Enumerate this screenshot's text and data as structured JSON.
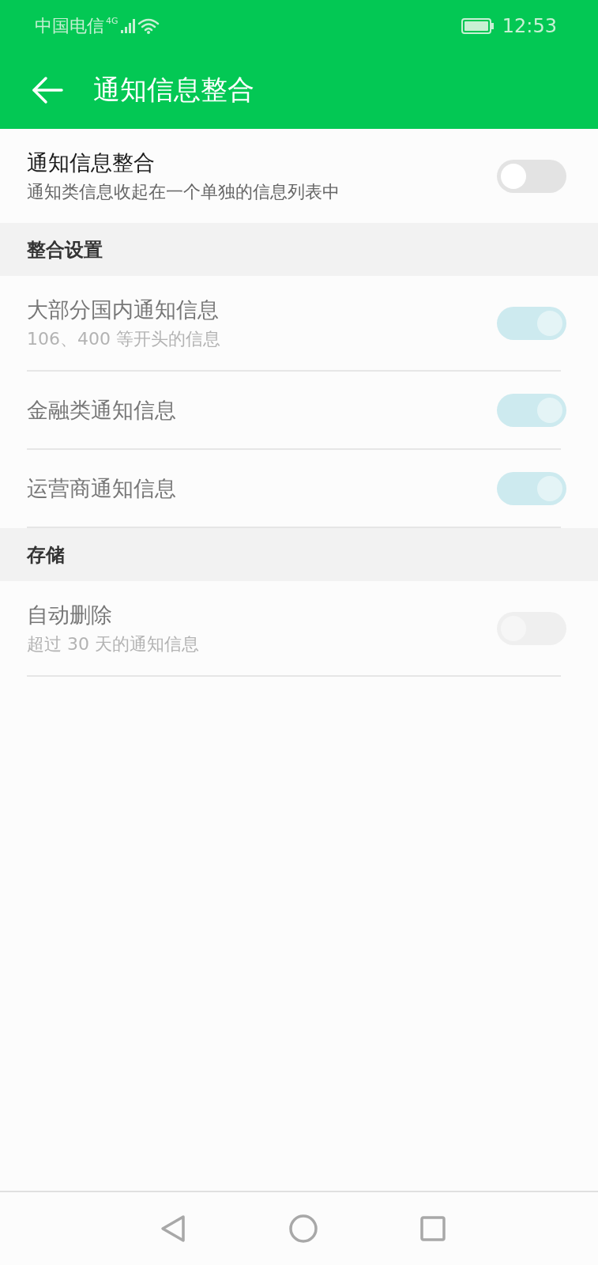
{
  "status_bar": {
    "carrier": "中国电信",
    "network": "4G",
    "time": "12:53"
  },
  "app_bar": {
    "title": "通知信息整合"
  },
  "sections": [
    {
      "items": [
        {
          "title": "通知信息整合",
          "subtitle": "通知类信息收起在一个单独的信息列表中",
          "on": false,
          "disabled": false
        }
      ]
    },
    {
      "header": "整合设置",
      "items": [
        {
          "title": "大部分国内通知信息",
          "subtitle": "106、400 等开头的信息",
          "on": true,
          "disabled": true
        },
        {
          "title": "金融类通知信息",
          "on": true,
          "disabled": true
        },
        {
          "title": "运营商通知信息",
          "on": true,
          "disabled": true
        }
      ]
    },
    {
      "header": "存储",
      "items": [
        {
          "title": "自动删除",
          "subtitle": "超过 30 天的通知信息",
          "on": false,
          "disabled": true
        }
      ]
    }
  ]
}
